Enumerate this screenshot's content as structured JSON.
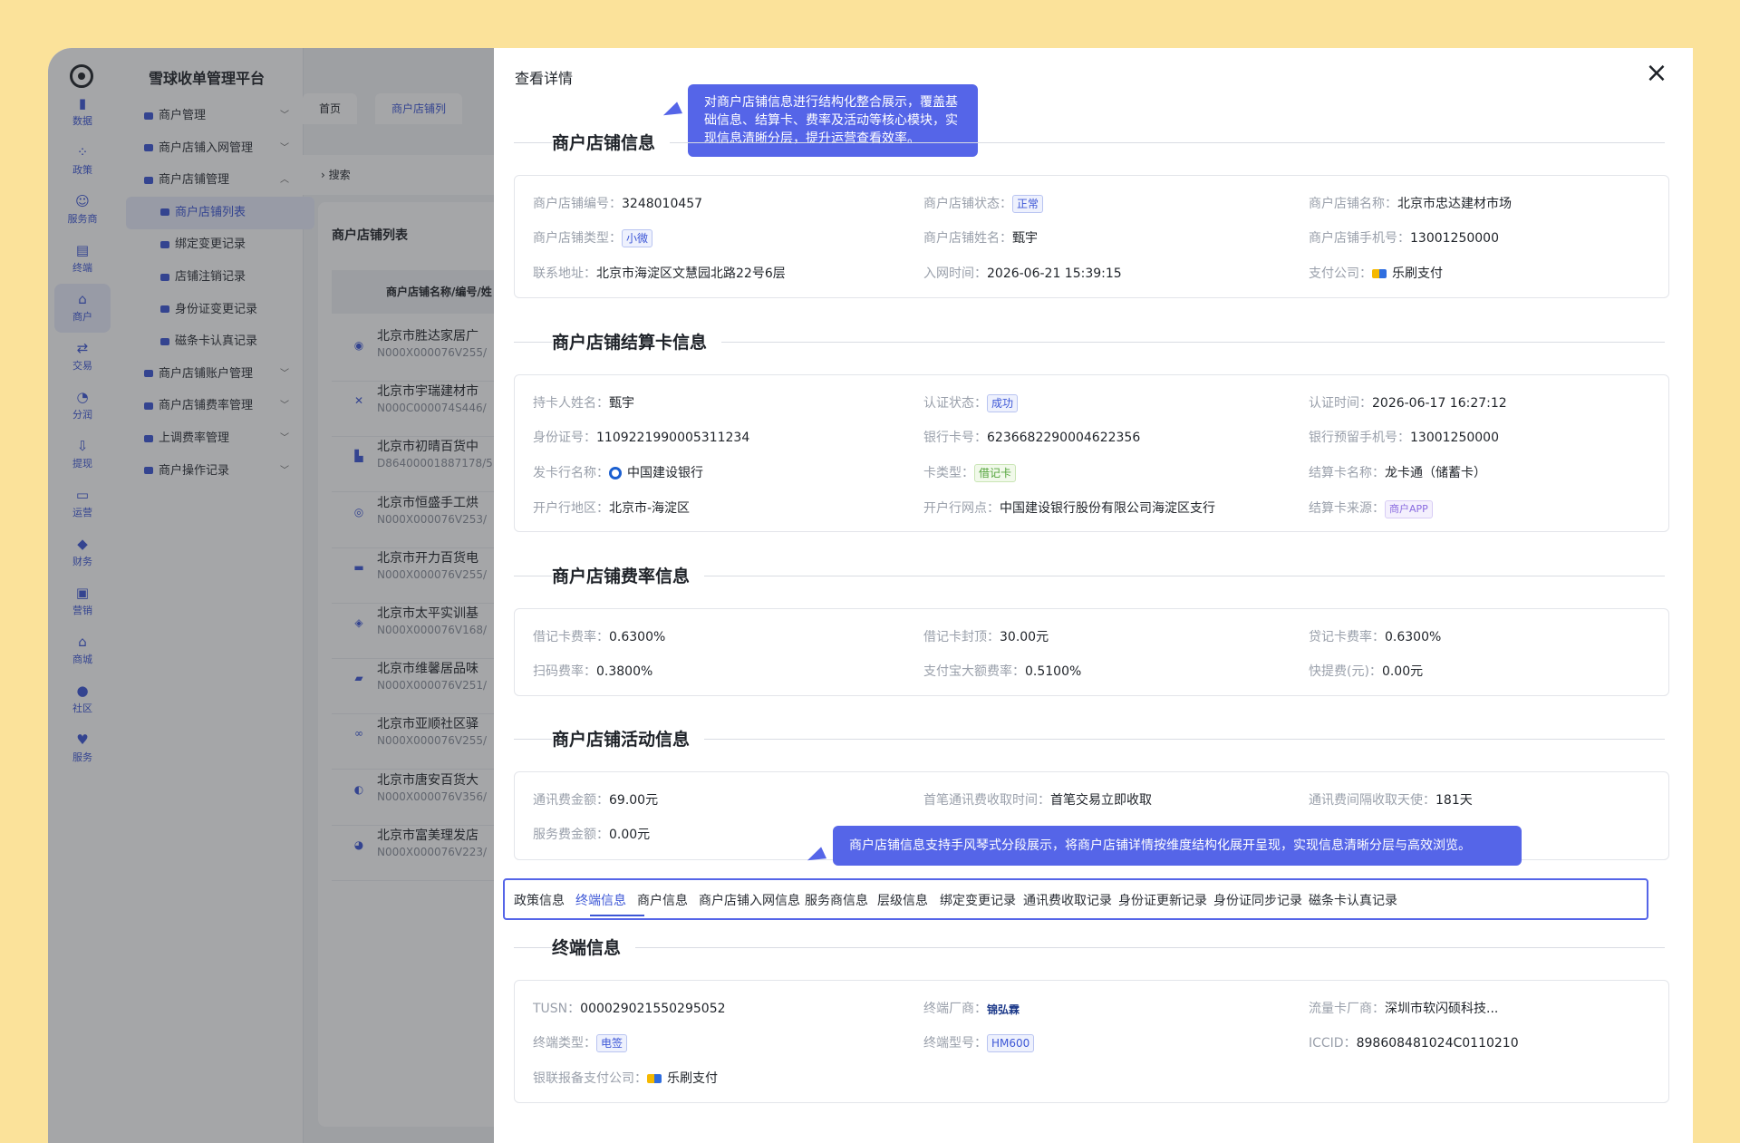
{
  "app": {
    "title": "雪球收单管理平台"
  },
  "rail": [
    {
      "label": "数据",
      "icon": "bar-chart-icon"
    },
    {
      "label": "政策",
      "icon": "grid-icon"
    },
    {
      "label": "服务商",
      "icon": "user-gear-icon"
    },
    {
      "label": "终端",
      "icon": "terminal-icon"
    },
    {
      "label": "商户",
      "icon": "store-icon",
      "active": true
    },
    {
      "label": "交易",
      "icon": "exchange-icon"
    },
    {
      "label": "分润",
      "icon": "split-icon"
    },
    {
      "label": "提现",
      "icon": "withdraw-icon"
    },
    {
      "label": "运营",
      "icon": "monitor-icon"
    },
    {
      "label": "财务",
      "icon": "finance-icon"
    },
    {
      "label": "营销",
      "icon": "gift-icon"
    },
    {
      "label": "商城",
      "icon": "shop-icon"
    },
    {
      "label": "社区",
      "icon": "chat-icon"
    },
    {
      "label": "服务",
      "icon": "service-icon"
    }
  ],
  "nav": [
    {
      "label": "商户管理",
      "type": "group"
    },
    {
      "label": "商户店铺入网管理",
      "type": "group"
    },
    {
      "label": "商户店铺管理",
      "type": "group",
      "open": true
    },
    {
      "label": "商户店铺列表",
      "type": "sub",
      "on": true
    },
    {
      "label": "绑定变更记录",
      "type": "sub"
    },
    {
      "label": "店铺注销记录",
      "type": "sub"
    },
    {
      "label": "身份证变更记录",
      "type": "sub"
    },
    {
      "label": "磁条卡认真记录",
      "type": "sub"
    },
    {
      "label": "商户店铺账户管理",
      "type": "group"
    },
    {
      "label": "商户店铺费率管理",
      "type": "group"
    },
    {
      "label": "上调费率管理",
      "type": "group"
    },
    {
      "label": "商户操作记录",
      "type": "group"
    }
  ],
  "topTabs": [
    "首页",
    "商户店铺列"
  ],
  "search": "搜索",
  "list": {
    "title": "商户店铺列表",
    "header": "商户店铺名称/编号/姓",
    "rows": [
      {
        "name": "北京市胜达家居广",
        "code": "N000X000076V255/"
      },
      {
        "name": "北京市宇瑞建材市",
        "code": "N000C000074S446/"
      },
      {
        "name": "北京市初晴百货中",
        "code": "D86400001887178/5"
      },
      {
        "name": "北京市恒盛手工烘",
        "code": "N000X000076V253/"
      },
      {
        "name": "北京市开力百货电",
        "code": "N000X000076V255/"
      },
      {
        "name": "北京市太平实训基",
        "code": "N000X000076V168/"
      },
      {
        "name": "北京市维馨居品味",
        "code": "N000X000076V251/"
      },
      {
        "name": "北京市亚顺社区驿",
        "code": "N000X000076V255/"
      },
      {
        "name": "北京市唐安百货大",
        "code": "N000X000076V356/"
      },
      {
        "name": "北京市富美理发店",
        "code": "N000X000076V223/"
      }
    ]
  },
  "drawer": {
    "title": "查看详情",
    "tip1": "对商户店铺信息进行结构化整合展示，覆盖基础信息、结算卡、费率及活动等核心模块，实现信息清晰分层，提升运营查看效率。",
    "tip2": "商户店铺信息支持手风琴式分段展示，将商户店铺详情按维度结构化展开呈现，实现信息清晰分层与高效浏览。",
    "s1": {
      "title": "商户店铺信息",
      "no_k": "商户店铺编号：",
      "no_v": "3248010457",
      "status_k": "商户店铺状态：",
      "status_v": "正常",
      "name_k": "商户店铺名称：",
      "name_v": "北京市忠达建材市场",
      "type_k": "商户店铺类型：",
      "type_v": "小微",
      "owner_k": "商户店铺姓名：",
      "owner_v": "甄宇",
      "phone_k": "商户店铺手机号：",
      "phone_v": "13001250000",
      "addr_k": "联系地址：",
      "addr_v": "北京市海淀区文慧园北路22号6层",
      "join_k": "入网时间：",
      "join_v": "2026-06-21 15:39:15",
      "pay_k": "支付公司：",
      "pay_v": "乐刷支付"
    },
    "s2": {
      "title": "商户店铺结算卡信息",
      "holder_k": "持卡人姓名：",
      "holder_v": "甄宇",
      "auth_k": "认证状态：",
      "auth_v": "成功",
      "authtime_k": "认证时间：",
      "authtime_v": "2026-06-17 16:27:12",
      "id_k": "身份证号：",
      "id_v": "1109221990005311234",
      "card_k": "银行卡号：",
      "card_v": "6236682290004622356",
      "bphone_k": "银行预留手机号：",
      "bphone_v": "13001250000",
      "bank_k": "发卡行名称：",
      "bank_v": "中国建设银行",
      "ctype_k": "卡类型：",
      "ctype_v": "借记卡",
      "cname_k": "结算卡名称：",
      "cname_v": "龙卡通（储蓄卡）",
      "area_k": "开户行地区：",
      "area_v": "北京市-海淀区",
      "branch_k": "开户行网点：",
      "branch_v": "中国建设银行股份有限公司海淀区支行",
      "src_k": "结算卡来源：",
      "src_v": "商户APP"
    },
    "s3": {
      "title": "商户店铺费率信息",
      "debit_k": "借记卡费率：",
      "debit_v": "0.6300%",
      "cap_k": "借记卡封顶：",
      "cap_v": "30.00元",
      "credit_k": "贷记卡费率：",
      "credit_v": "0.6300%",
      "scan_k": "扫码费率：",
      "scan_v": "0.3800%",
      "ali_k": "支付宝大额费率：",
      "ali_v": "0.5100%",
      "fast_k": "快提费(元)：",
      "fast_v": "0.00元"
    },
    "s4": {
      "title": "商户店铺活动信息",
      "comm_k": "通讯费金额：",
      "comm_v": "69.00元",
      "first_k": "首笔通讯费收取时间：",
      "first_v": "首笔交易立即收取",
      "interval_k": "通讯费间隔收取天使：",
      "interval_v": "181天",
      "svc_k": "服务费金额：",
      "svc_v": "0.00元"
    },
    "tabs": [
      "政策信息",
      "终端信息",
      "商户信息",
      "商户店铺入网信息",
      "服务商信息",
      "层级信息",
      "绑定变更记录",
      "通讯费收取记录",
      "身份证更新记录",
      "身份证同步记录",
      "磁条卡认真记录"
    ],
    "s5": {
      "title": "终端信息",
      "tusn_k": "TUSN：",
      "tusn_v": "000029021550295052",
      "maker_k": "终端厂商：",
      "maker_v": "锦弘霖",
      "flow_k": "流量卡厂商：",
      "flow_v": "深圳市软闪硕科技...",
      "ttype_k": "终端类型：",
      "ttype_v": "电签",
      "model_k": "终端型号：",
      "model_v": "HM600",
      "iccid_k": "ICCID：",
      "iccid_v": "898608481024C0110210",
      "union_k": "银联报备支付公司：",
      "union_v": "乐刷支付"
    }
  }
}
